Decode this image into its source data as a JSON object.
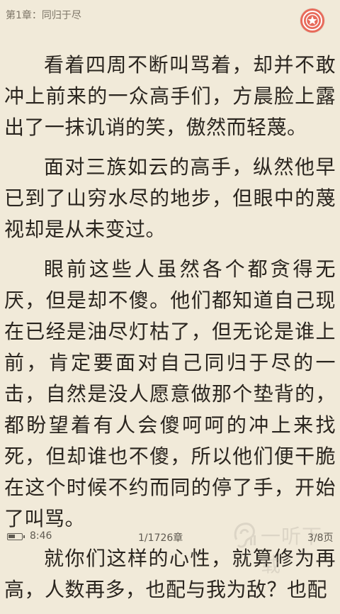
{
  "header": {
    "chapter_title": "第1章：同归于尽",
    "badge_icon": "target-icon",
    "badge_color": "#e86a5a"
  },
  "content": {
    "paragraphs": [
      "看着四周不断叫骂着，却并不敢冲上前来的一众高手们，方晨脸上露出了一抹讥诮的笑，傲然而轻蔑。",
      "面对三族如云的高手，纵然他早已到了山穷水尽的地步，但眼中的蔑视却是从未变过。",
      "眼前这些人虽然各个都贪得无厌，但是却不傻。他们都知道自己现在已经是油尽灯枯了，但无论是谁上前，肯定要面对自己同归于尽的一击，自然是没人愿意做那个垫背的，都盼望着有人会傻呵呵的冲上来找死，但却谁也不傻，所以他们便干脆在这个时候不约而同的停了手，开始了叫骂。",
      "就你们这样的心性，就算修为再高，人数再多，也配与我为敌？也配"
    ]
  },
  "footer": {
    "battery_icon": "battery-icon",
    "battery_level": 0.55,
    "time": "8:46",
    "chapter_progress": "1/1726章",
    "page_progress": "3/8页"
  },
  "watermark": {
    "text": "一听下载",
    "icon": "ear-logo-icon"
  },
  "colors": {
    "background": "#f1ead9",
    "text": "#2a251f",
    "muted": "#7c7466"
  }
}
